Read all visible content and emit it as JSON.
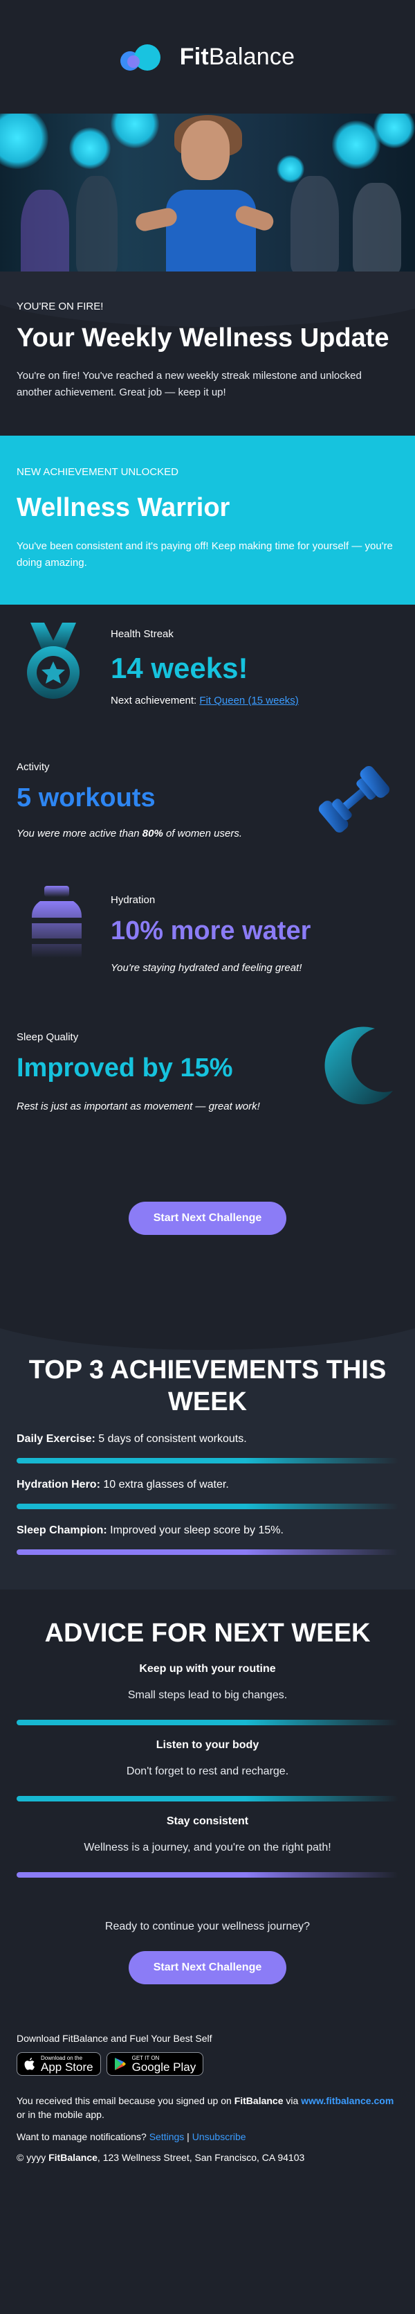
{
  "brand": {
    "name_bold": "Fit",
    "name_rest": "Balance"
  },
  "intro": {
    "kicker": "YOU'RE ON FIRE!",
    "title": "Your Weekly Wellness Update",
    "text": "You're on fire! You've reached a new weekly streak milestone and unlocked another achievement. Great job — keep it up!"
  },
  "achievement": {
    "kicker": "NEW ACHIEVEMENT UNLOCKED",
    "title": "Wellness Warrior",
    "text": "You've been consistent and it's paying off! Keep making time for yourself — you're doing amazing."
  },
  "streak": {
    "label": "Health Streak",
    "value": "14 weeks!",
    "next_prefix": "Next achievement: ",
    "next_link": "Fit Queen (15 weeks)"
  },
  "activity": {
    "label": "Activity",
    "value": "5 workouts",
    "sub_prefix": "You were more active than ",
    "sub_bold": "80%",
    "sub_suffix": " of women users."
  },
  "hydration": {
    "label": "Hydration",
    "value": "10% more water",
    "sub": "You're staying hydrated and feeling great!"
  },
  "sleep": {
    "label": "Sleep Quality",
    "value": "Improved by 15%",
    "sub": "Rest is just as important as movement — great work!"
  },
  "cta": {
    "label": "Start Next Challenge"
  },
  "top3": {
    "title": "TOP 3 ACHIEVEMENTS THIS WEEK",
    "items": [
      {
        "bold": "Daily Exercise:",
        "text": " 5 days of consistent workouts."
      },
      {
        "bold": "Hydration Hero:",
        "text": " 10 extra glasses of water."
      },
      {
        "bold": "Sleep Champion:",
        "text": " Improved your sleep score by 15%."
      }
    ]
  },
  "advice": {
    "title": "ADVICE FOR NEXT WEEK",
    "items": [
      {
        "heading": "Keep up with your routine",
        "text": "Small steps lead to big changes."
      },
      {
        "heading": "Listen to your body",
        "text": "Don't forget to rest and recharge."
      },
      {
        "heading": "Stay consistent",
        "text": "Wellness is a journey, and you're on the right path!"
      }
    ],
    "closing": "Ready to continue your wellness journey?"
  },
  "footer": {
    "download": "Download  FitBalance and Fuel Your Best Self",
    "appstore_small": "Download on the",
    "appstore_big": "App Store",
    "gplay_small": "GET IT ON",
    "gplay_big": "Google Play",
    "reason_prefix": "You received this email because you signed up on ",
    "reason_brand": "FitBalance",
    "reason_via": " via ",
    "reason_url": "www.fitbalance.com",
    "reason_suffix": " or in the mobile app.",
    "manage_prefix": "Want to manage notifications? ",
    "settings": "Settings",
    "separator": " | ",
    "unsubscribe": "Unsubscribe",
    "copyright_prefix": "© yyyy ",
    "copyright_brand": "FitBalance",
    "copyright_suffix": ", 123 Wellness Street, San Francisco, CA 94103"
  },
  "colors": {
    "background": "#1e222b",
    "teal": "#16c3de",
    "blue": "#3b8cf6",
    "purple": "#8b7cf6",
    "link": "#3b9cff"
  }
}
